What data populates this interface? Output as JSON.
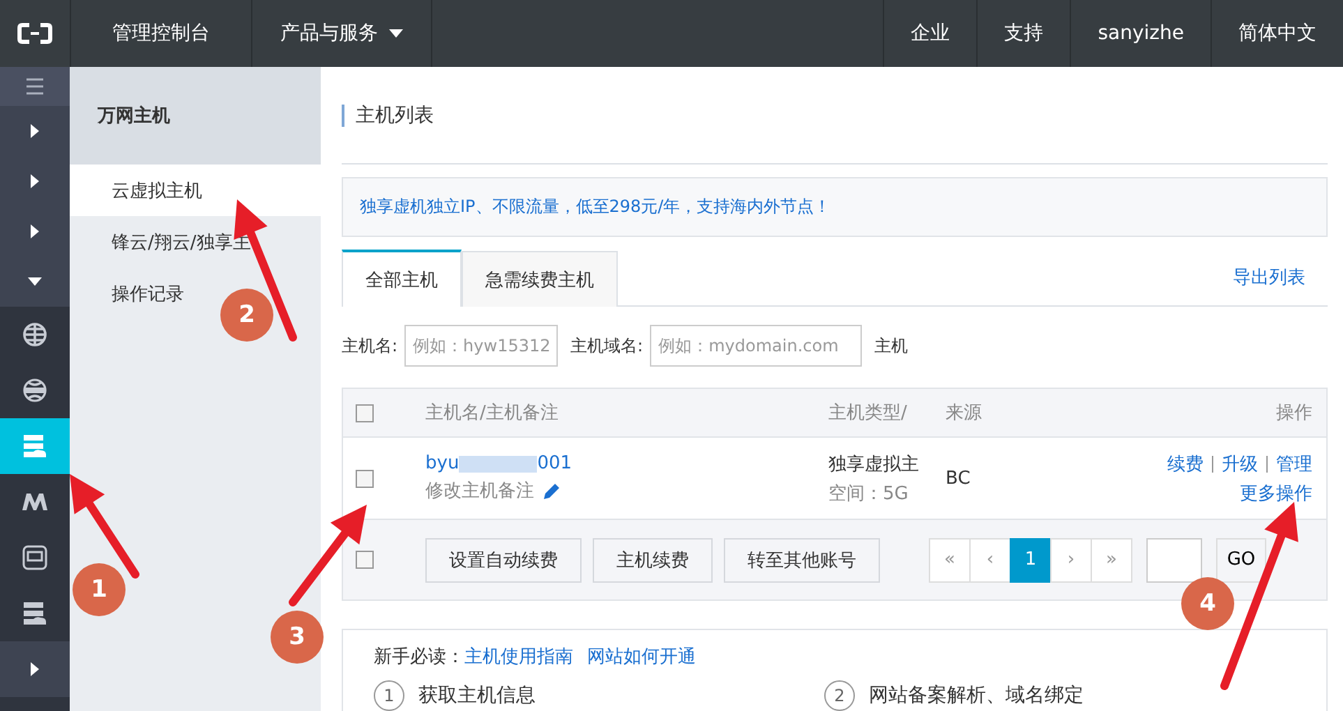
{
  "top_bar": {
    "menu": [
      {
        "label": "管理控制台",
        "dropdown": false
      },
      {
        "label": "产品与服务",
        "dropdown": true
      }
    ],
    "right_menu": [
      "企业",
      "支持",
      "sanyizhe",
      "简体中文"
    ]
  },
  "icon_sidebar": [
    {
      "kind": "menu",
      "selected": false
    },
    {
      "kind": "expand",
      "selected": false
    },
    {
      "kind": "expand",
      "selected": false
    },
    {
      "kind": "expand",
      "selected": false
    },
    {
      "kind": "collapse",
      "selected": false
    },
    {
      "kind": "globe",
      "selected": false
    },
    {
      "kind": "dns",
      "selected": false
    },
    {
      "kind": "server",
      "selected": true
    },
    {
      "kind": "zigzag",
      "selected": false
    },
    {
      "kind": "monitor",
      "selected": false
    },
    {
      "kind": "server",
      "selected": false
    },
    {
      "kind": "expand",
      "selected": false
    }
  ],
  "sub_sidebar": {
    "title": "万网主机",
    "items": [
      {
        "label": "云虚拟主机",
        "selected": true
      },
      {
        "label": "锋云/翔云/独享主",
        "selected": false
      },
      {
        "label": "操作记录",
        "selected": false
      }
    ]
  },
  "page_title": "主机列表",
  "banner": "独享虚机独立IP、不限流量，低至298元/年，支持海内外节点！",
  "tabs": [
    {
      "label": "全部主机",
      "selected": true
    },
    {
      "label": "急需续费主机",
      "selected": false
    }
  ],
  "export_link": "导出列表",
  "filters": [
    {
      "label": "主机名:",
      "placeholder": "例如：hyw15312"
    },
    {
      "label": "主机域名:",
      "placeholder": "例如：mydomain.com"
    }
  ],
  "filter_cut_label": "主机",
  "table": {
    "header_checked": false,
    "footer_checked": false,
    "columns": [
      "主机名/主机备注",
      "主机类型/",
      "来源",
      "操作"
    ],
    "rows": [
      {
        "checked": false,
        "name_start": "byu",
        "name_end": "001",
        "note": "修改主机备注",
        "type": "独享虚拟主",
        "space": "空间：5G",
        "source": "BC",
        "actions": [
          "续费",
          "升级",
          "管理"
        ],
        "more": "更多操作"
      }
    ],
    "bulk_actions": [
      "设置自动续费",
      "主机续费",
      "转至其他账号"
    ]
  },
  "pagination": {
    "pages": [
      {
        "label": "«",
        "selected": false
      },
      {
        "label": "‹",
        "selected": false
      },
      {
        "label": "1",
        "selected": true
      },
      {
        "label": "›",
        "selected": false
      },
      {
        "label": "»",
        "selected": false
      }
    ],
    "go": "GO"
  },
  "guide": {
    "label": "新手必读：",
    "links": [
      "主机使用指南",
      "网站如何开通"
    ],
    "steps": [
      {
        "number": "1",
        "text": "获取主机信息"
      },
      {
        "number": "2",
        "text": "网站备案解析、域名绑定"
      }
    ]
  },
  "annotations": [
    "1",
    "2",
    "3",
    "4"
  ]
}
